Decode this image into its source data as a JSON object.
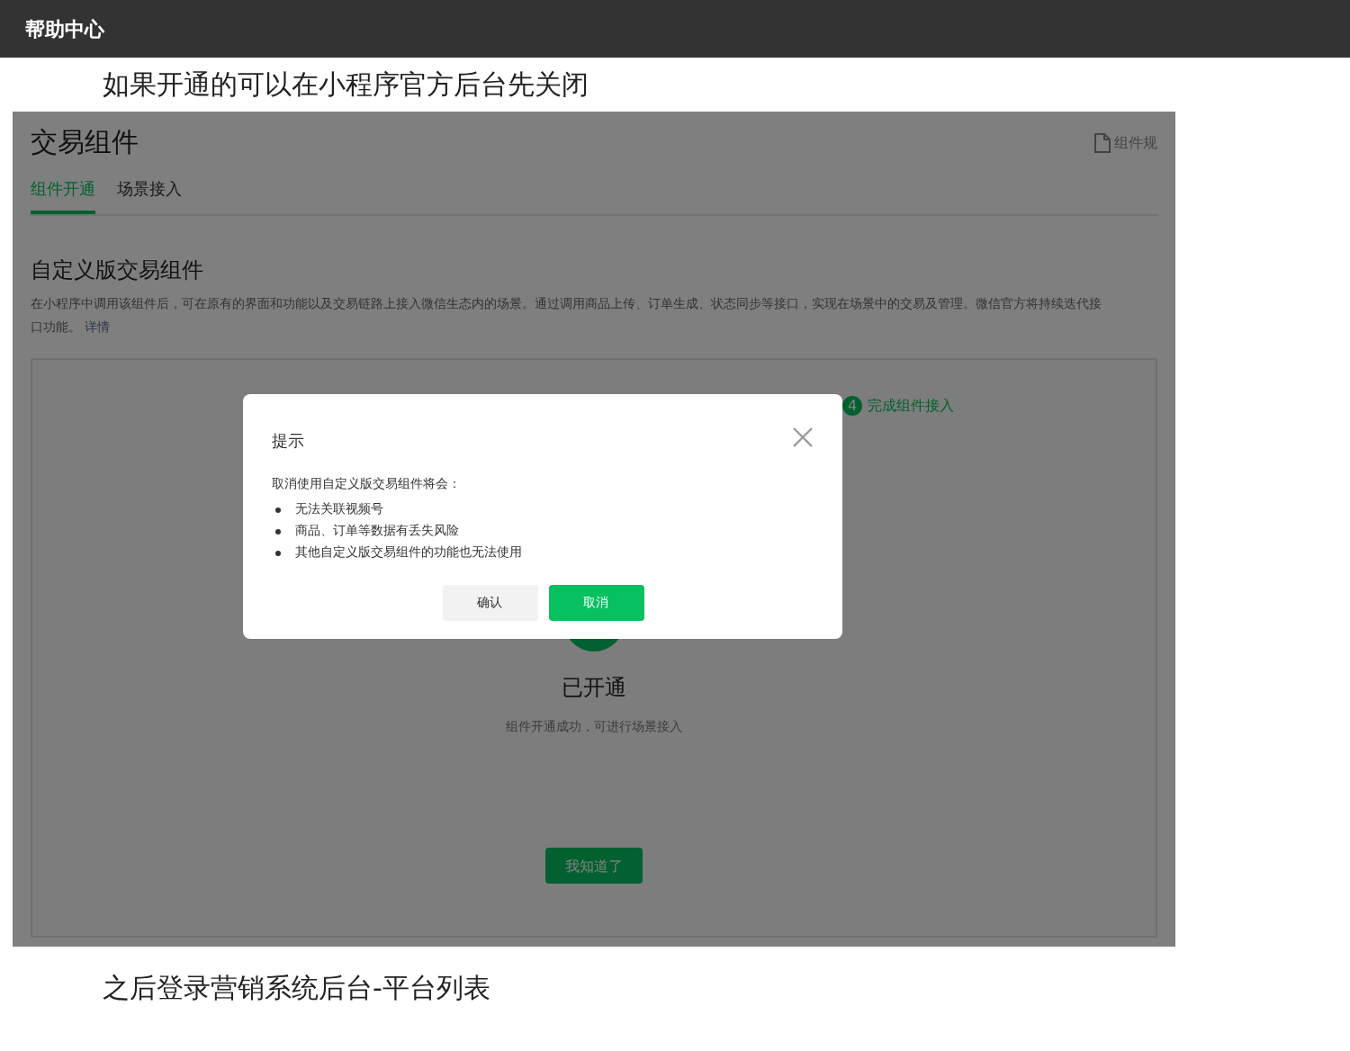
{
  "header": {
    "title": "帮助中心"
  },
  "caption_top": "如果开通的可以在小程序官方后台先关闭",
  "screenshot": {
    "page_title": "交易组件",
    "top_link": "组件规",
    "tabs": [
      {
        "label": "组件开通",
        "selected": true
      },
      {
        "label": "场景接入",
        "selected": false
      }
    ],
    "section_title": "自定义版交易组件",
    "description": "在小程序中调用该组件后，可在原有的界面和功能以及交易链路上接入微信生态内的场景。通过调用商品上传、订单生成、状态同步等接口，实现在场景中的交易及管理。微信官方将持续迭代接口功能。",
    "description_link": "详情",
    "step": {
      "number": "4",
      "label": "完成组件接入"
    },
    "status_title": "已开通",
    "status_text": "组件开通成功，可进行场景接入",
    "ok_button": "我知道了",
    "dialog": {
      "title": "提示",
      "intro": "取消使用自定义版交易组件将会：",
      "bullets": [
        "无法关联视频号",
        "商品、订单等数据有丢失风险",
        "其他自定义版交易组件的功能也无法使用"
      ],
      "buttons": [
        {
          "label": "确认",
          "kind": "secondary"
        },
        {
          "label": "取消",
          "kind": "primary"
        }
      ]
    }
  },
  "caption_bottom": "之后登录营销系统后台-平台列表"
}
